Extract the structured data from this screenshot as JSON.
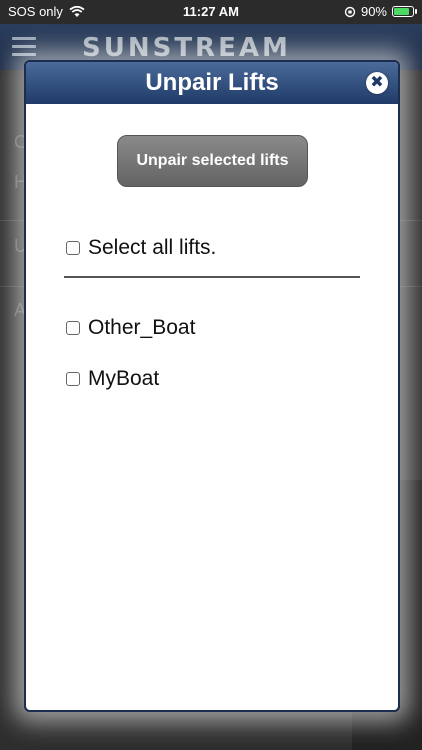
{
  "status_bar": {
    "carrier": "SOS only",
    "time": "11:27 AM",
    "battery_percent": "90%",
    "battery_level": 0.9,
    "battery_color": "#4cd964"
  },
  "app_header": {
    "brand": "SUNSTREAM",
    "menu_icon": "hamburger-icon"
  },
  "background_rows": [
    "C",
    "H",
    "U",
    "A"
  ],
  "modal": {
    "title": "Unpair Lifts",
    "close_icon": "close-icon",
    "unpair_button_label": "Unpair selected lifts",
    "select_all_label": "Select all lifts.",
    "lifts": [
      {
        "name": "Other_Boat",
        "checked": false
      },
      {
        "name": "MyBoat",
        "checked": false
      }
    ]
  },
  "colors": {
    "header_top": "#4b6b9a",
    "header_bottom": "#1f3a67",
    "button_gray": "#6f6f6f"
  }
}
